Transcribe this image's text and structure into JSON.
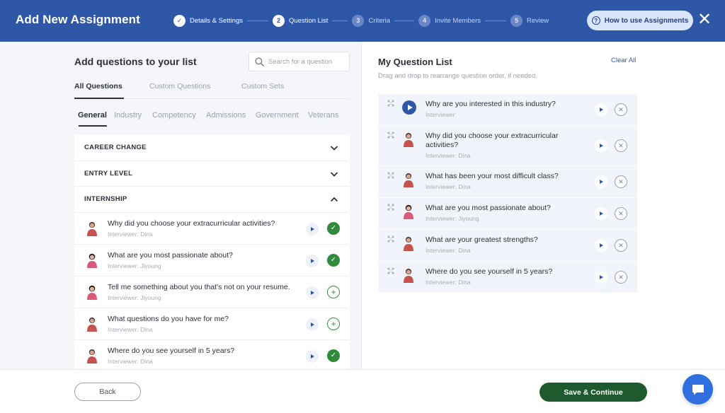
{
  "header": {
    "title": "Add New Assignment",
    "steps": [
      {
        "num": "✓",
        "label": "Details & Settings",
        "state": "done"
      },
      {
        "num": "2",
        "label": "Question List",
        "state": "active"
      },
      {
        "num": "3",
        "label": "Criteria",
        "state": "pending"
      },
      {
        "num": "4",
        "label": "Invite Members",
        "state": "pending"
      },
      {
        "num": "5",
        "label": "Review",
        "state": "pending"
      }
    ],
    "help_label": "How to use Assignments",
    "help_icon": "?",
    "close_label": "✕"
  },
  "left": {
    "title": "Add questions to your list",
    "search_placeholder": "Search for a question",
    "tabs": [
      "All Questions",
      "Custom Questions",
      "Custom Sets"
    ],
    "subtabs": [
      "General",
      "Industry",
      "Competency",
      "Admissions",
      "Government",
      "Veterans"
    ],
    "categories": [
      "CAREER CHANGE",
      "ENTRY LEVEL",
      "INTERNSHIP"
    ],
    "questions": [
      {
        "text": "Why did you choose your extracurricular activities?",
        "interviewer": "Interviewer: Dina",
        "added": true
      },
      {
        "text": "What are you most passionate about?",
        "interviewer": "Interviewer: Jiyoung",
        "added": true
      },
      {
        "text": "Tell me something about you that's not on your resume.",
        "interviewer": "Interviewer: Jiyoung",
        "added": false
      },
      {
        "text": "What questions do you have for me?",
        "interviewer": "Interviewer: Dina",
        "added": false
      },
      {
        "text": "Where do you see yourself in 5 years?",
        "interviewer": "Interviewer: Dina",
        "added": true
      }
    ]
  },
  "right": {
    "title": "My Question List",
    "clear_all": "Clear All",
    "subtitle": "Drag and drop to rearrange question order, if needed.",
    "questions": [
      {
        "text": "Why are you interested in this industry?",
        "interviewer": "Interviewer:"
      },
      {
        "text": "Why did you choose your extracurricular activities?",
        "interviewer": "Interviewer: Dina"
      },
      {
        "text": "What has been your most difficult class?",
        "interviewer": "Interviewer: Dina"
      },
      {
        "text": "What are you most passionate about?",
        "interviewer": "Interviewer: Jiyoung"
      },
      {
        "text": "What are your greatest strengths?",
        "interviewer": "Interviewer: Dina"
      },
      {
        "text": "Where do you see yourself in 5 years?",
        "interviewer": "Interviewer: Dina"
      }
    ]
  },
  "footer": {
    "back_label": "Back",
    "save_label": "Save & Continue"
  },
  "colors": {
    "brand": "#2f57a7",
    "success": "#2f8a3a",
    "save": "#1f5a2e",
    "chat": "#2f6fe0"
  }
}
